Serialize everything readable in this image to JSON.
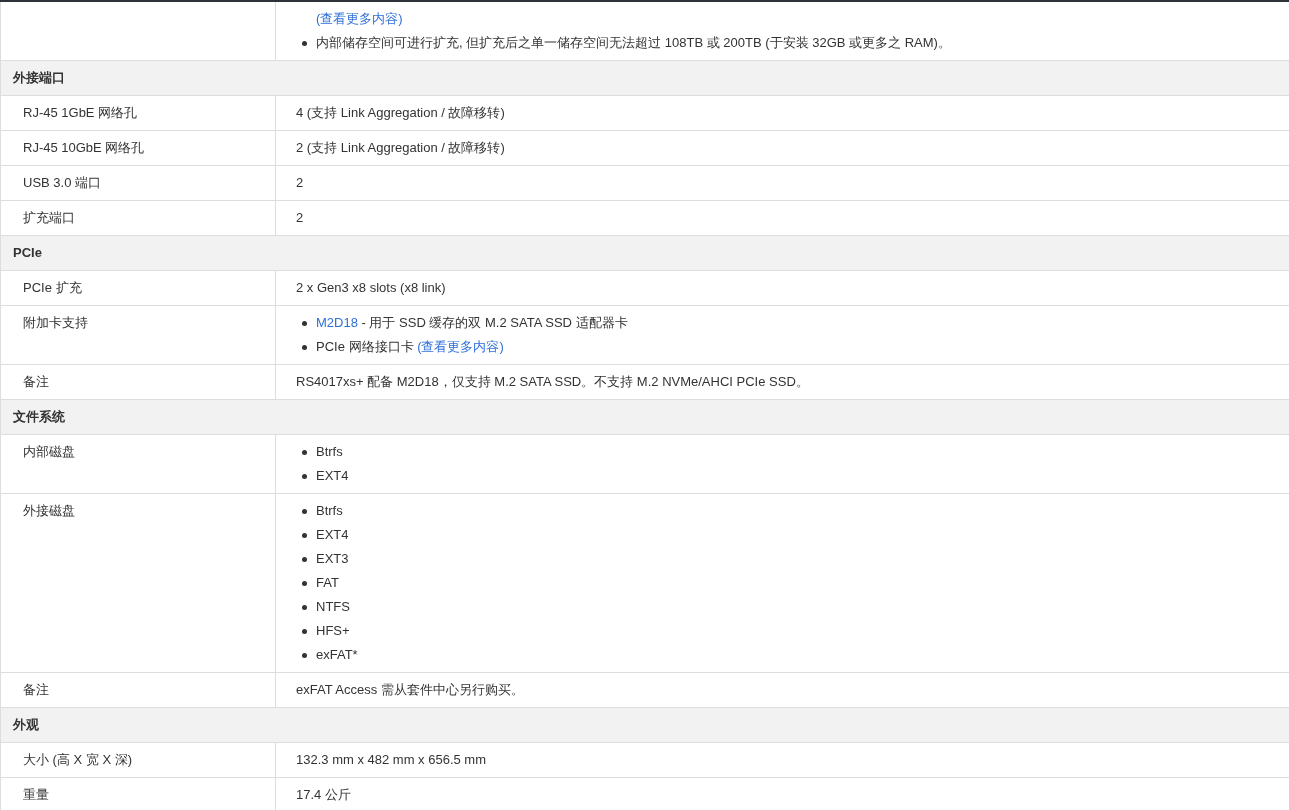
{
  "sections": [
    {
      "rows": [
        {
          "label": "",
          "lines": [
            {
              "kind": "continued",
              "parts": [
                {
                  "text": "(查看更多内容)",
                  "link": true
                }
              ]
            },
            {
              "kind": "bullet",
              "parts": [
                {
                  "text": "内部储存空间可进行扩充, 但扩充后之单一储存空间无法超过 108TB 或 200TB (于安装 32GB 或更多之 RAM)。",
                  "link": false
                }
              ]
            }
          ]
        }
      ]
    },
    {
      "title": "外接端口",
      "rows": [
        {
          "label": "RJ-45 1GbE 网络孔",
          "lines": [
            {
              "kind": "text",
              "parts": [
                {
                  "text": "4 (支持 Link Aggregation / 故障移转)",
                  "link": false
                }
              ]
            }
          ]
        },
        {
          "label": "RJ-45 10GbE 网络孔",
          "lines": [
            {
              "kind": "text",
              "parts": [
                {
                  "text": "2 (支持 Link Aggregation / 故障移转)",
                  "link": false
                }
              ]
            }
          ]
        },
        {
          "label": "USB 3.0 端口",
          "lines": [
            {
              "kind": "text",
              "parts": [
                {
                  "text": "2",
                  "link": false
                }
              ]
            }
          ]
        },
        {
          "label": "扩充端口",
          "lines": [
            {
              "kind": "text",
              "parts": [
                {
                  "text": "2",
                  "link": false
                }
              ]
            }
          ]
        }
      ]
    },
    {
      "title": "PCIe",
      "rows": [
        {
          "label": "PCIe 扩充",
          "lines": [
            {
              "kind": "text",
              "parts": [
                {
                  "text": "2 x Gen3 x8 slots (x8 link)",
                  "link": false
                }
              ]
            }
          ]
        },
        {
          "label": "附加卡支持",
          "lines": [
            {
              "kind": "bullet",
              "parts": [
                {
                  "text": "M2D18",
                  "link": true
                },
                {
                  "text": " - 用于 SSD 缓存的双 M.2 SATA SSD 适配器卡",
                  "link": false
                }
              ]
            },
            {
              "kind": "bullet",
              "parts": [
                {
                  "text": "PCIe 网络接口卡 ",
                  "link": false
                },
                {
                  "text": "(查看更多内容)",
                  "link": true
                }
              ]
            }
          ]
        },
        {
          "label": "备注",
          "lines": [
            {
              "kind": "text",
              "parts": [
                {
                  "text": "RS4017xs+ 配备 M2D18，仅支持 M.2 SATA SSD。不支持 M.2 NVMe/AHCI PCIe SSD。",
                  "link": false
                }
              ]
            }
          ]
        }
      ]
    },
    {
      "title": "文件系统",
      "rows": [
        {
          "label": "内部磁盘",
          "lines": [
            {
              "kind": "bullet",
              "parts": [
                {
                  "text": "Btrfs",
                  "link": false
                }
              ]
            },
            {
              "kind": "bullet",
              "parts": [
                {
                  "text": "EXT4",
                  "link": false
                }
              ]
            }
          ]
        },
        {
          "label": "外接磁盘",
          "lines": [
            {
              "kind": "bullet",
              "parts": [
                {
                  "text": "Btrfs",
                  "link": false
                }
              ]
            },
            {
              "kind": "bullet",
              "parts": [
                {
                  "text": "EXT4",
                  "link": false
                }
              ]
            },
            {
              "kind": "bullet",
              "parts": [
                {
                  "text": "EXT3",
                  "link": false
                }
              ]
            },
            {
              "kind": "bullet",
              "parts": [
                {
                  "text": "FAT",
                  "link": false
                }
              ]
            },
            {
              "kind": "bullet",
              "parts": [
                {
                  "text": "NTFS",
                  "link": false
                }
              ]
            },
            {
              "kind": "bullet",
              "parts": [
                {
                  "text": "HFS+",
                  "link": false
                }
              ]
            },
            {
              "kind": "bullet",
              "parts": [
                {
                  "text": "exFAT*",
                  "link": false
                }
              ]
            }
          ]
        },
        {
          "label": "备注",
          "lines": [
            {
              "kind": "text",
              "parts": [
                {
                  "text": "exFAT Access 需从套件中心另行购买。",
                  "link": false
                }
              ]
            }
          ]
        }
      ]
    },
    {
      "title": "外观",
      "rows": [
        {
          "label": "大小 (高 X 宽 X 深)",
          "lines": [
            {
              "kind": "text",
              "parts": [
                {
                  "text": "132.3 mm x 482 mm x 656.5 mm",
                  "link": false
                }
              ]
            }
          ]
        },
        {
          "label": "重量",
          "lines": [
            {
              "kind": "text",
              "parts": [
                {
                  "text": "17.4 公斤",
                  "link": false
                }
              ]
            }
          ]
        }
      ]
    }
  ]
}
